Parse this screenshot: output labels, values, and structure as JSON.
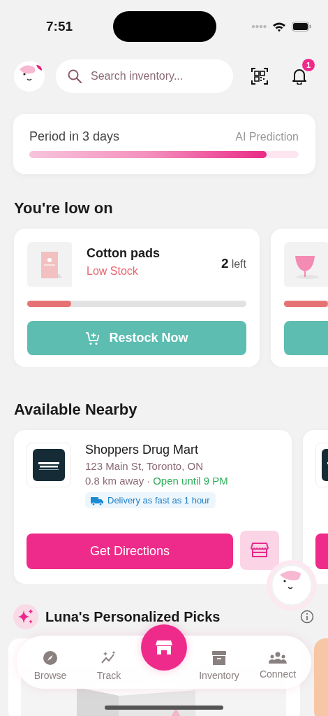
{
  "status_bar": {
    "time": "7:51"
  },
  "header": {
    "search": {
      "placeholder": "Search inventory..."
    },
    "notifications": {
      "badge": "1"
    }
  },
  "period": {
    "title": "Period in 3 days",
    "tag": "AI Prediction",
    "level": 0.88
  },
  "low_stock": {
    "title": "You're low on",
    "items": [
      {
        "kind": "full",
        "name": "Cotton pads",
        "status": "Low Stock",
        "count": "2",
        "unit": "left",
        "level": 0.2,
        "button": "Restock Now"
      },
      {
        "kind": "peek",
        "level": 0.2
      }
    ]
  },
  "nearby": {
    "title": "Available Nearby",
    "stores": [
      {
        "kind": "full",
        "name": "Shoppers Drug Mart",
        "address": "123 Main St, Toronto, ON",
        "distance": "0.8 km away",
        "separator": "·",
        "hours": "Open until 9 PM",
        "delivery": "Delivery as fast as 1 hour",
        "button": "Get Directions"
      },
      {
        "kind": "peek"
      }
    ]
  },
  "picks": {
    "title": "Luna's Personalized Picks"
  },
  "nav": {
    "items": [
      {
        "kind": "tab",
        "label": "Browse",
        "selected": false
      },
      {
        "kind": "tab",
        "label": "Track",
        "selected": false
      },
      {
        "kind": "center",
        "selected": true
      },
      {
        "kind": "tab",
        "label": "Inventory",
        "selected": false
      },
      {
        "kind": "tab",
        "label": "Connect",
        "selected": false
      }
    ]
  }
}
